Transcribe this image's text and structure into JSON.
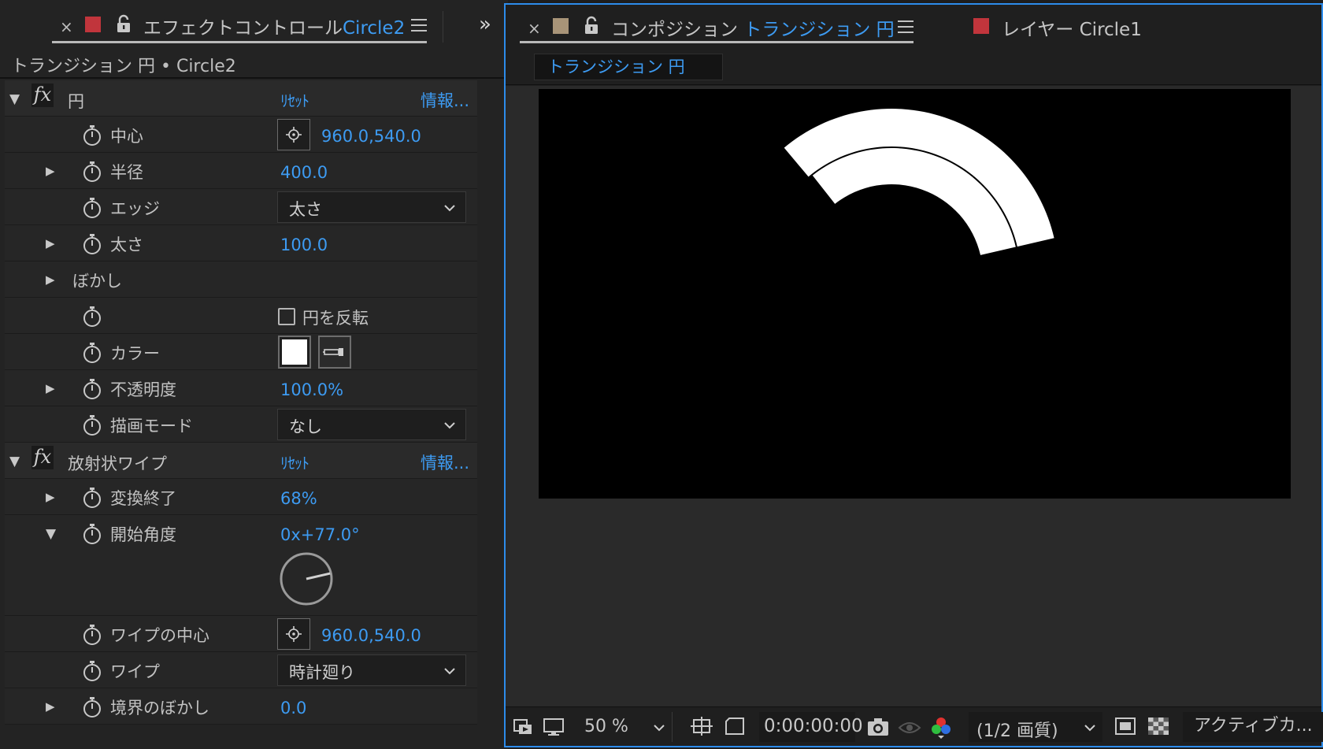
{
  "effect_controls": {
    "tab": {
      "close": "×",
      "title_prefix": "エフェクトコントロール",
      "title_layer": "Circle2",
      "swatch_color": "#c1353c"
    },
    "expand_glyph": "»",
    "breadcrumb": "トランジション 円 • Circle2",
    "effects": [
      {
        "name": "円",
        "reset_label": "ﾘｾｯﾄ",
        "about_label": "情報...",
        "properties": [
          {
            "name": "中心",
            "value": "960.0,540.0"
          },
          {
            "name": "半径",
            "value": "400.0"
          },
          {
            "name": "エッジ",
            "value": "太さ"
          },
          {
            "name": "太さ",
            "value": "100.0"
          },
          {
            "name": "ぼかし"
          },
          {
            "checkbox_label": "円を反転",
            "checked": false
          },
          {
            "name": "カラー",
            "color": "#ffffff"
          },
          {
            "name": "不透明度",
            "value": "100.0%"
          },
          {
            "name": "描画モード",
            "value": "なし"
          }
        ]
      },
      {
        "name": "放射状ワイプ",
        "reset_label": "ﾘｾｯﾄ",
        "about_label": "情報...",
        "properties": [
          {
            "name": "変換終了",
            "value": "68%"
          },
          {
            "name": "開始角度",
            "value": "0x+77.0°",
            "angle_degrees": 77
          },
          {
            "name": "ワイプの中心",
            "value": "960.0,540.0"
          },
          {
            "name": "ワイプ",
            "value": "時計廻り"
          },
          {
            "name": "境界のぼかし",
            "value": "0.0"
          }
        ]
      }
    ]
  },
  "composition": {
    "tab": {
      "close": "×",
      "title_prefix": "コンポジション",
      "title_comp": "トランジション 円",
      "swatch_color": "#a89478"
    },
    "layer_tab": {
      "title": "レイヤー Circle1",
      "swatch_color": "#c1353c"
    },
    "flow_tab": "トランジション 円",
    "preview": {
      "background": "#000000",
      "ring_color": "#ffffff"
    },
    "statusbar": {
      "zoom": "50 %",
      "timecode": "0:00:00:00",
      "resolution": "(1/2 画質)",
      "camera": "アクティブカ..."
    }
  },
  "colors": {
    "accent_blue": "#3d9bf2",
    "panel_focus_border": "#2d8ceb"
  }
}
